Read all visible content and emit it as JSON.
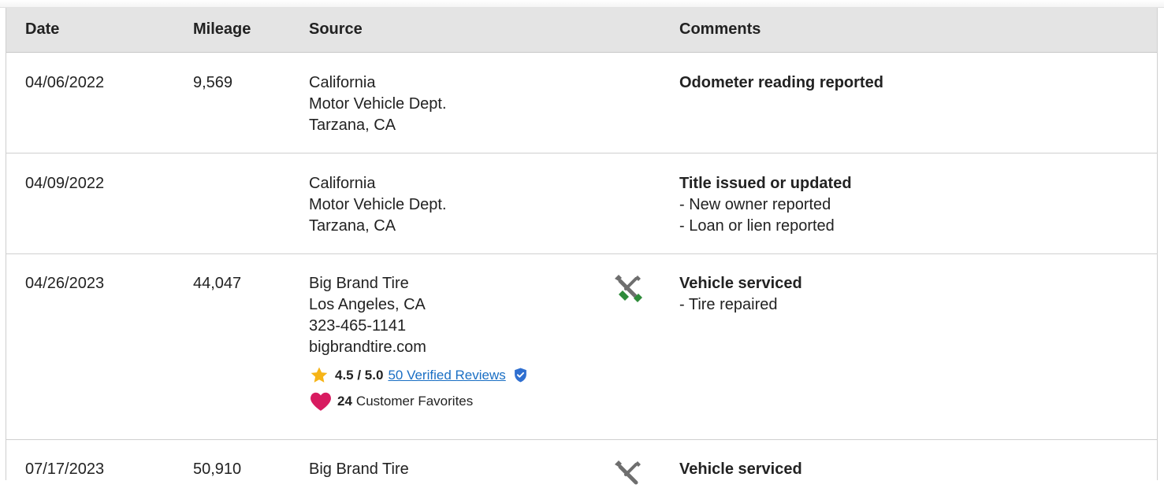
{
  "columns": {
    "date": "Date",
    "mileage": "Mileage",
    "source": "Source",
    "comments": "Comments"
  },
  "records": [
    {
      "date": "04/06/2022",
      "mileage": "9,569",
      "source": [
        "California",
        "Motor Vehicle Dept.",
        "Tarzana, CA"
      ],
      "comment_title": "Odometer reading reported",
      "comment_details": []
    },
    {
      "date": "04/09/2022",
      "mileage": "",
      "source": [
        "California",
        "Motor Vehicle Dept.",
        "Tarzana, CA"
      ],
      "comment_title": "Title issued or updated",
      "comment_details": [
        "- New owner reported",
        "- Loan or lien reported"
      ]
    },
    {
      "date": "04/26/2023",
      "mileage": "44,047",
      "source": [
        "Big Brand Tire",
        "Los Angeles, CA",
        "323-465-1141",
        "bigbrandtire.com"
      ],
      "icon": "wrench-screwdriver-icon",
      "rating_score": "4.5 / 5.0",
      "rating_link": "50 Verified Reviews",
      "favorites_count": "24",
      "favorites_label": "Customer Favorites",
      "comment_title": "Vehicle serviced",
      "comment_details": [
        "- Tire repaired"
      ]
    },
    {
      "date": "07/17/2023",
      "mileage": "50,910",
      "source": [
        "Big Brand Tire"
      ],
      "icon": "wrench-screwdriver-icon",
      "comment_title": "Vehicle serviced",
      "comment_details": []
    }
  ],
  "colors": {
    "header_bg": "#e4e4e4",
    "link": "#1a6fc4",
    "star": "#f6b417",
    "heart": "#d81b60",
    "shield": "#2f6fd0",
    "wrench_green": "#2e8b3a"
  }
}
